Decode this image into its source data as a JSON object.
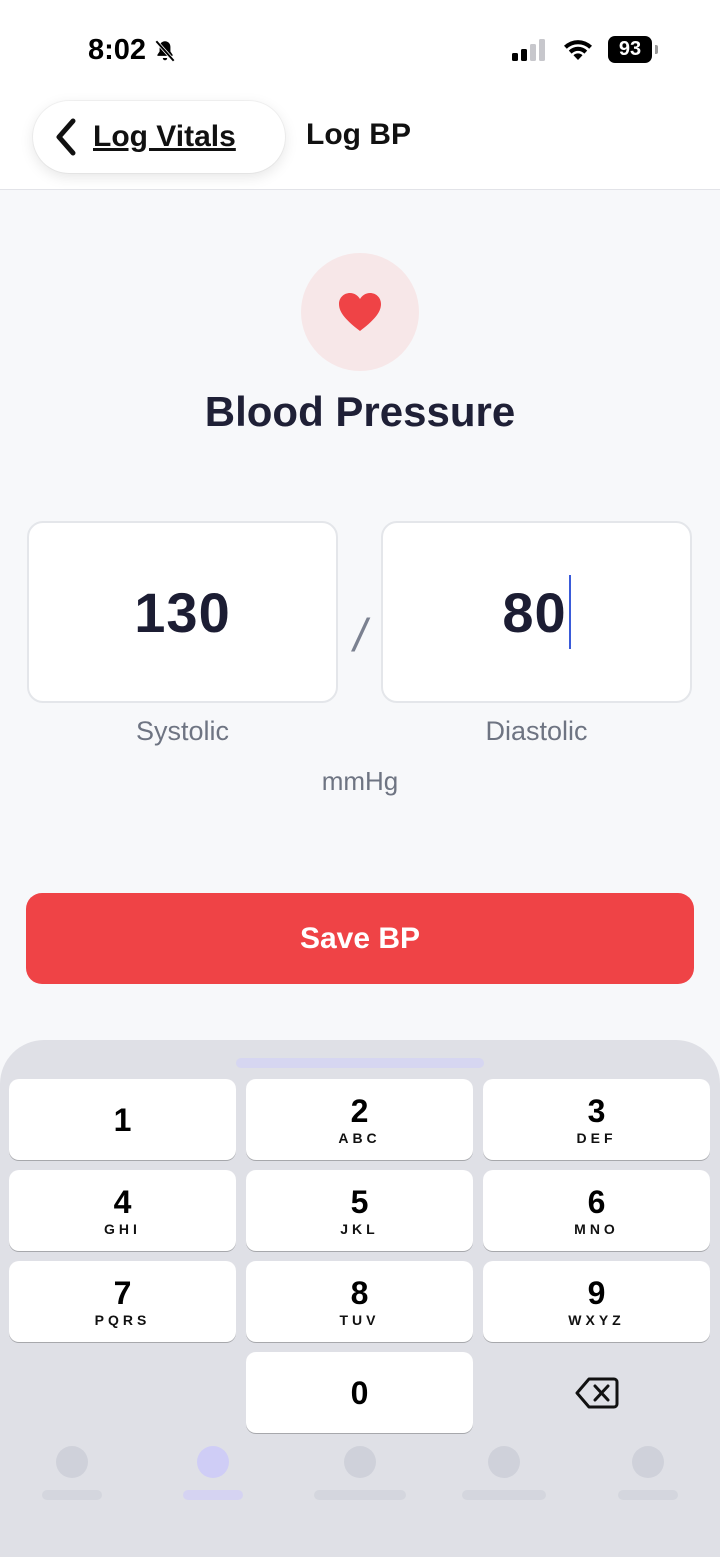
{
  "status_bar": {
    "time": "8:02",
    "battery": "93"
  },
  "nav": {
    "back_label": "Log Vitals",
    "title": "Log BP"
  },
  "header": {
    "icon": "heart-icon",
    "title": "Blood Pressure"
  },
  "reading": {
    "systolic_value": "130",
    "separator": "/",
    "diastolic_value": "80",
    "systolic_label": "Systolic",
    "diastolic_label": "Diastolic",
    "unit": "mmHg"
  },
  "save_button": {
    "label": "Save BP"
  },
  "keyboard": {
    "keys": [
      {
        "digit": "1",
        "letters": ""
      },
      {
        "digit": "2",
        "letters": "ABC"
      },
      {
        "digit": "3",
        "letters": "DEF"
      },
      {
        "digit": "4",
        "letters": "GHI"
      },
      {
        "digit": "5",
        "letters": "JKL"
      },
      {
        "digit": "6",
        "letters": "MNO"
      },
      {
        "digit": "7",
        "letters": "PQRS"
      },
      {
        "digit": "8",
        "letters": "TUV"
      },
      {
        "digit": "9",
        "letters": "WXYZ"
      },
      {
        "digit": "0",
        "letters": ""
      }
    ],
    "delete_icon": "backspace-icon"
  },
  "colors": {
    "accent": "#ef4346",
    "heart_bg": "#f7e7e8",
    "caret": "#3a5bd9"
  }
}
